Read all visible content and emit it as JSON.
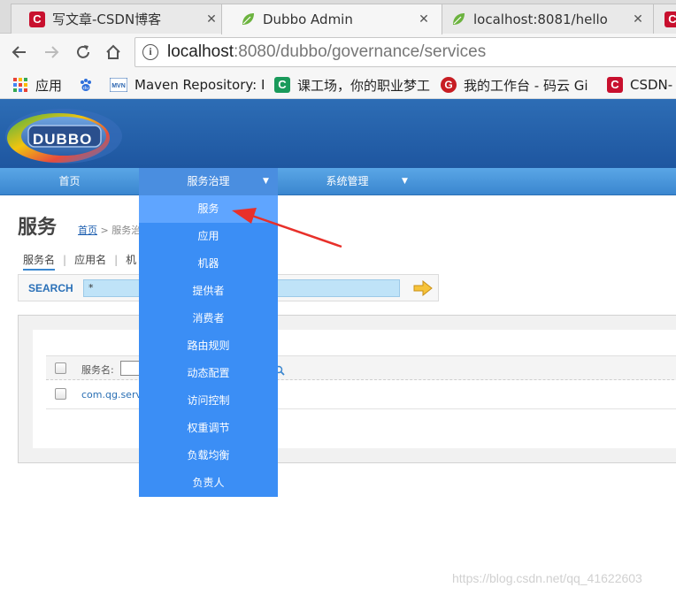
{
  "browser": {
    "tabs": [
      {
        "title": "写文章-CSDN博客",
        "favicon": "csdn-icon",
        "active": false
      },
      {
        "title": "Dubbo Admin",
        "favicon": "spring-leaf-icon",
        "active": true
      },
      {
        "title": "localhost:8081/hello",
        "favicon": "spring-leaf-icon",
        "active": false
      }
    ],
    "tab_close_symbol": "✕",
    "url_host": "localhost",
    "url_rest": ":8080/dubbo/governance/services",
    "bookmarks": [
      {
        "label": "应用",
        "icon": "apps-grid-icon"
      },
      {
        "label": "",
        "icon": "baidu-paw-icon"
      },
      {
        "label": "Maven Repository: I",
        "icon": "mvn-icon"
      },
      {
        "label": "课工场，你的职业梦工",
        "icon": "kgc-icon"
      },
      {
        "label": "我的工作台 - 码云 Gi",
        "icon": "gitee-icon"
      },
      {
        "label": "CSDN-",
        "icon": "csdn-icon"
      }
    ]
  },
  "app": {
    "logo_text": "DUBBO",
    "nav": [
      {
        "label": "首页"
      },
      {
        "label": "服务治理",
        "has_caret": true,
        "open": true
      },
      {
        "label": "系统管理",
        "has_caret": true
      }
    ],
    "caret_symbol": "▼",
    "dropdown": [
      "服务",
      "应用",
      "机器",
      "提供者",
      "消费者",
      "路由规则",
      "动态配置",
      "访问控制",
      "权重调节",
      "负载均衡",
      "负责人"
    ],
    "page_title": "服务",
    "breadcrumb_home": "首页",
    "breadcrumb_rest": " > 服务治",
    "subtabs": [
      "服务名",
      "应用名",
      "机"
    ],
    "subtab_sep": "|",
    "search_label": "SEARCH",
    "search_value": "*",
    "table_header_label": "服务名:",
    "rows": [
      {
        "service": "com.qg.serv"
      }
    ]
  },
  "watermark": "https://blog.csdn.net/qq_41622603",
  "colors": {
    "banner": "#1e56a0",
    "nav": "#3a86cf",
    "dropdown": "#3b8ef5",
    "dropdown_highlight": "#5fa5ff",
    "arrow": "#e8302a"
  }
}
